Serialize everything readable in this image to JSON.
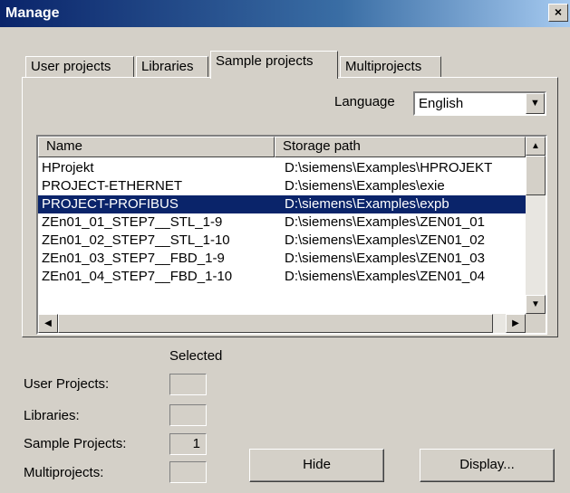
{
  "window": {
    "title": "Manage",
    "close_label": "×"
  },
  "tabs": [
    {
      "label": "User projects"
    },
    {
      "label": "Libraries"
    },
    {
      "label": "Sample projects"
    },
    {
      "label": "Multiprojects"
    }
  ],
  "active_tab": "Sample projects",
  "language": {
    "label": "Language",
    "value": "English"
  },
  "list": {
    "columns": [
      "Name",
      "Storage path"
    ],
    "rows": [
      {
        "name": "HProjekt",
        "path": "D:\\siemens\\Examples\\HPROJEKT"
      },
      {
        "name": "PROJECT-ETHERNET",
        "path": "D:\\siemens\\Examples\\exie"
      },
      {
        "name": "PROJECT-PROFIBUS",
        "path": "D:\\siemens\\Examples\\expb"
      },
      {
        "name": "ZEn01_01_STEP7__STL_1-9",
        "path": "D:\\siemens\\Examples\\ZEN01_01"
      },
      {
        "name": "ZEn01_02_STEP7__STL_1-10",
        "path": "D:\\siemens\\Examples\\ZEN01_02"
      },
      {
        "name": "ZEn01_03_STEP7__FBD_1-9",
        "path": "D:\\siemens\\Examples\\ZEN01_03"
      },
      {
        "name": "ZEn01_04_STEP7__FBD_1-10",
        "path": "D:\\siemens\\Examples\\ZEN01_04"
      }
    ],
    "selected_row": "PROJECT-PROFIBUS"
  },
  "selected": {
    "header": "Selected",
    "items": [
      {
        "label": "User Projects:",
        "value": ""
      },
      {
        "label": "Libraries:",
        "value": ""
      },
      {
        "label": "Sample Projects:",
        "value": "1"
      },
      {
        "label": "Multiprojects:",
        "value": ""
      }
    ]
  },
  "buttons": {
    "hide": "Hide",
    "display": "Display..."
  },
  "icons": {
    "close": "close-icon",
    "dropdown": "chevron-down-icon",
    "scroll_up": "arrow-up-icon",
    "scroll_down": "arrow-down-icon",
    "scroll_left": "arrow-left-icon",
    "scroll_right": "arrow-right-icon"
  }
}
